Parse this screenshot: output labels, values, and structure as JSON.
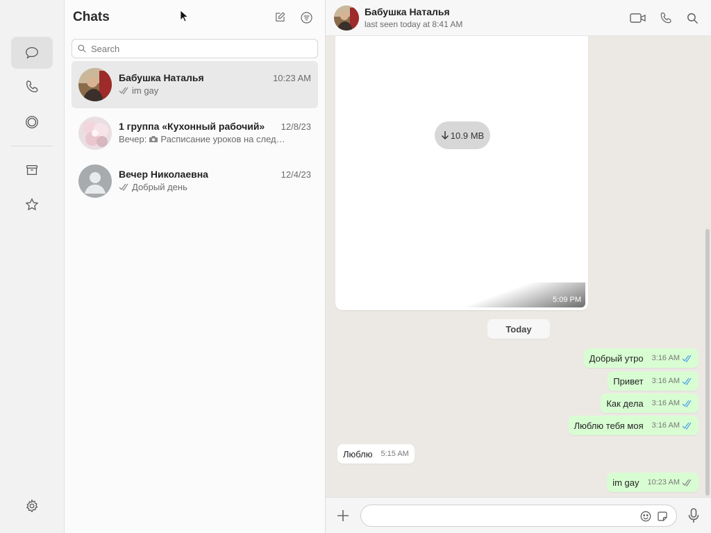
{
  "sidebar": {
    "items": [
      {
        "name": "chats",
        "icon": "chat-bubble-icon",
        "active": true
      },
      {
        "name": "calls",
        "icon": "phone-icon"
      },
      {
        "name": "status",
        "icon": "status-ring-icon"
      },
      {
        "name": "archived",
        "icon": "archive-icon"
      },
      {
        "name": "starred",
        "icon": "star-icon"
      },
      {
        "name": "settings",
        "icon": "gear-icon"
      }
    ]
  },
  "chat_list": {
    "title": "Chats",
    "search_placeholder": "Search",
    "chats": [
      {
        "name": "Бабушка Наталья",
        "time": "10:23 AM",
        "preview": "im gay",
        "ticks": true,
        "selected": true
      },
      {
        "name": "1 группа «Кухонный рабочий»",
        "time": "12/8/23",
        "preview_sender": "Вечер:",
        "preview": "Расписание уроков на след…",
        "photo": true
      },
      {
        "name": "Вечер Николаевна",
        "time": "12/4/23",
        "preview": "Добрый день",
        "ticks": true
      }
    ]
  },
  "conversation": {
    "contact_name": "Бабушка Наталья",
    "status": "last seen today at 8:41 AM",
    "media": {
      "size": "10.9 MB",
      "time": "5:09 PM"
    },
    "day_divider": "Today",
    "messages": [
      {
        "text": "Добрый утро",
        "time": "3:16 AM",
        "direction": "out",
        "read": true
      },
      {
        "text": "Привет",
        "time": "3:16 AM",
        "direction": "out",
        "read": true
      },
      {
        "text": "Как дела",
        "time": "3:16 AM",
        "direction": "out",
        "read": true
      },
      {
        "text": "Люблю тебя моя",
        "time": "3:16 AM",
        "direction": "out",
        "read": true
      },
      {
        "text": "Люблю",
        "time": "5:15 AM",
        "direction": "in"
      },
      {
        "text": "im gay",
        "time": "10:23 AM",
        "direction": "out",
        "read": false
      }
    ]
  },
  "composer": {
    "placeholder": ""
  },
  "colors": {
    "outgoing_bubble": "#d9fdd3",
    "read_tick": "#53a6e6",
    "background": "#ece9e4"
  }
}
